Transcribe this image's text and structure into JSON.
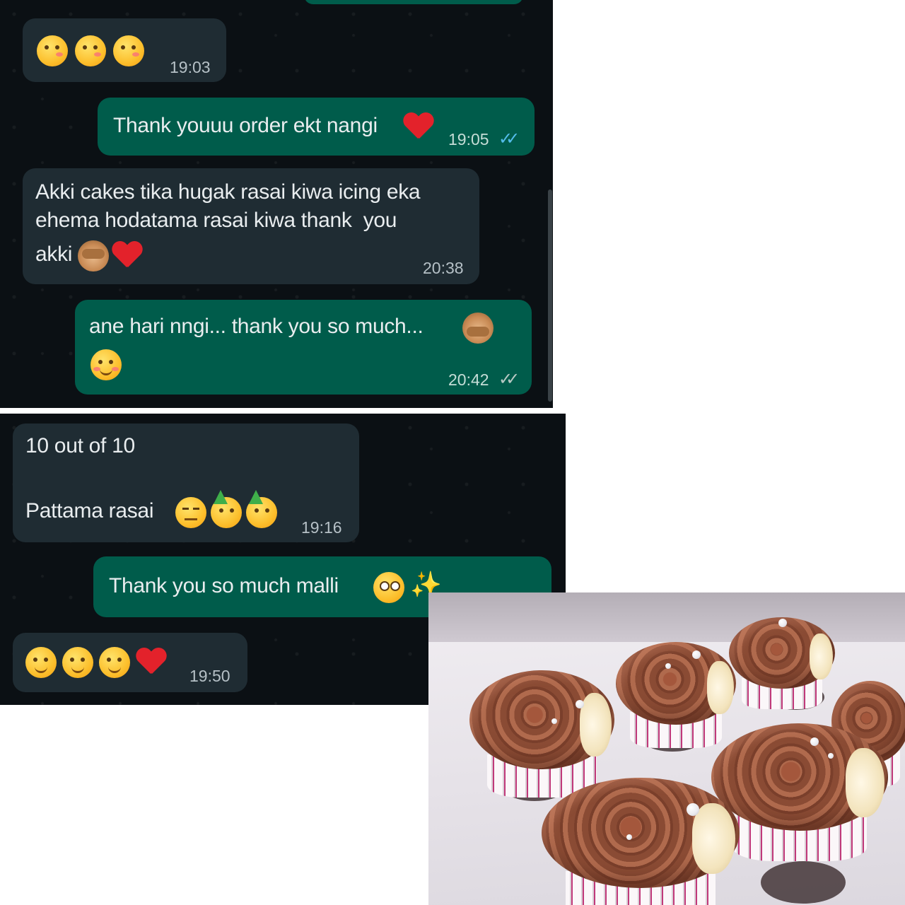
{
  "chat_top": {
    "messages": [
      {
        "direction": "incoming",
        "emoji": [
          "kissing-heart-face",
          "kissing-heart-face",
          "kissing-heart-face"
        ],
        "text": "",
        "time": "19:03"
      },
      {
        "direction": "outgoing",
        "text": "Thank youuu order ekt nangi",
        "emoji_after": [
          "red-heart"
        ],
        "time": "19:05",
        "status": "read"
      },
      {
        "direction": "incoming",
        "lines": [
          "Akki cakes tika hugak rasai kiwa icing eka",
          "ehema hodatama rasai kiwa thank  you",
          "akki"
        ],
        "emoji_after": [
          "see-no-evil-monkey",
          "red-heart"
        ],
        "time": "20:38"
      },
      {
        "direction": "outgoing",
        "lines": [
          "ane hari nngi... thank you so much..."
        ],
        "emoji_after": [
          "speak-no-evil-monkey",
          "smiling-face-with-hearts"
        ],
        "time": "20:42",
        "status": "delivered"
      }
    ]
  },
  "chat_bottom": {
    "messages": [
      {
        "direction": "incoming",
        "lines": [
          "10 out of 10",
          "",
          "Pattama rasai"
        ],
        "emoji_after": [
          "confounded-face",
          "partying-face",
          "partying-face"
        ],
        "time": "19:16"
      },
      {
        "direction": "outgoing",
        "text": "Thank you so much malli",
        "emoji_after": [
          "pleading-face",
          "sparkles"
        ]
      },
      {
        "direction": "incoming",
        "emoji": [
          "yum-face",
          "yum-face",
          "yum-face",
          "red-heart"
        ],
        "text": "",
        "time": "19:50"
      }
    ]
  },
  "photo": {
    "subject": "chocolate frosted cupcakes in a box"
  },
  "colors": {
    "incoming_bubble": "#1f2c33",
    "outgoing_bubble": "#005c4b",
    "chat_bg": "#0b1014",
    "read_ticks": "#53bdeb"
  }
}
